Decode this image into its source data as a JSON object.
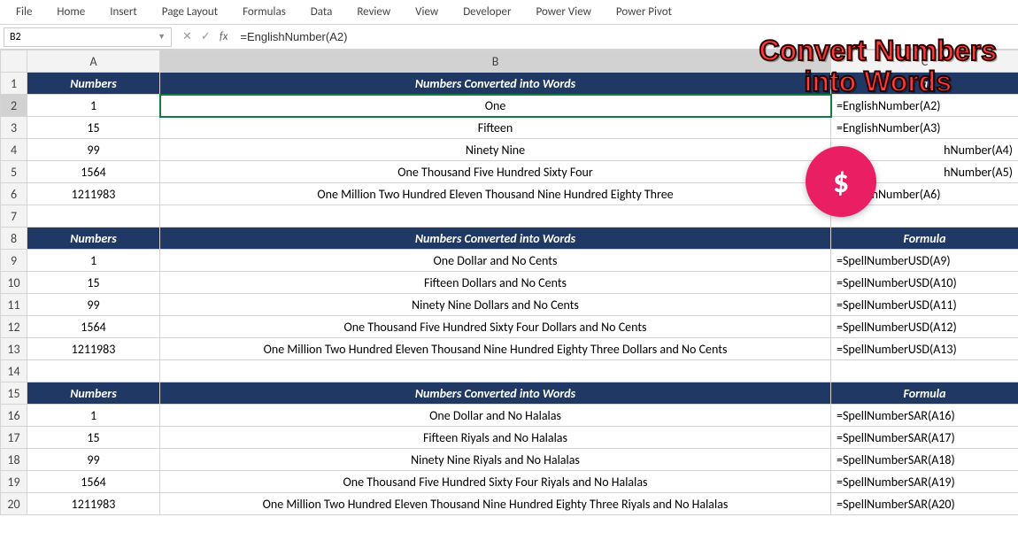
{
  "ribbon": [
    "File",
    "Home",
    "Insert",
    "Page Layout",
    "Formulas",
    "Data",
    "Review",
    "View",
    "Developer",
    "Power View",
    "Power Pivot"
  ],
  "name_box": "B2",
  "formula_bar": "=EnglishNumber(A2)",
  "columns": [
    "A",
    "B",
    "C"
  ],
  "overlay": {
    "line1": "Convert Numbers",
    "line2": "into Words",
    "badge": "$"
  },
  "headers": {
    "col1": "Numbers",
    "col2": "Numbers Converted into Words",
    "col3": "Formula"
  },
  "block1": [
    {
      "row": "2",
      "n": "1",
      "w": "One",
      "f": "=EnglishNumber(A2)"
    },
    {
      "row": "3",
      "n": "15",
      "w": "Fifteen",
      "f": "=EnglishNumber(A3)"
    },
    {
      "row": "4",
      "n": "99",
      "w": "Ninety Nine",
      "f": "hNumber(A4)"
    },
    {
      "row": "5",
      "n": "1564",
      "w": "One Thousand Five Hundred Sixty Four",
      "f": "hNumber(A5)"
    },
    {
      "row": "6",
      "n": "1211983",
      "w": "One Million Two Hundred Eleven Thousand Nine Hundred Eighty Three",
      "f": "=EnglishNumber(A6)"
    }
  ],
  "block2": [
    {
      "row": "9",
      "n": "1",
      "w": "One Dollar and No Cents",
      "f": "=SpellNumberUSD(A9)"
    },
    {
      "row": "10",
      "n": "15",
      "w": "Fifteen Dollars and No Cents",
      "f": "=SpellNumberUSD(A10)"
    },
    {
      "row": "11",
      "n": "99",
      "w": "Ninety Nine Dollars and No Cents",
      "f": "=SpellNumberUSD(A11)"
    },
    {
      "row": "12",
      "n": "1564",
      "w": "One Thousand Five Hundred Sixty Four Dollars and No Cents",
      "f": "=SpellNumberUSD(A12)"
    },
    {
      "row": "13",
      "n": "1211983",
      "w": "One Million Two Hundred Eleven Thousand Nine Hundred Eighty Three Dollars and No Cents",
      "f": "=SpellNumberUSD(A13)"
    }
  ],
  "block3": [
    {
      "row": "16",
      "n": "1",
      "w": "One Dollar and No Halalas",
      "f": "=SpellNumberSAR(A16)"
    },
    {
      "row": "17",
      "n": "15",
      "w": "Fifteen Riyals and No Halalas",
      "f": "=SpellNumberSAR(A17)"
    },
    {
      "row": "18",
      "n": "99",
      "w": "Ninety Nine Riyals and No Halalas",
      "f": "=SpellNumberSAR(A18)"
    },
    {
      "row": "19",
      "n": "1564",
      "w": "One Thousand Five Hundred Sixty Four Riyals and No Halalas",
      "f": "=SpellNumberSAR(A19)"
    },
    {
      "row": "20",
      "n": "1211983",
      "w": "One Million Two Hundred Eleven Thousand Nine Hundred Eighty Three Riyals and No Halalas",
      "f": "=SpellNumberSAR(A20)"
    }
  ],
  "header_row_block1": "1",
  "empty_row_a": "7",
  "header_row_block2": "8",
  "empty_row_b": "14",
  "header_row_block3": "15"
}
